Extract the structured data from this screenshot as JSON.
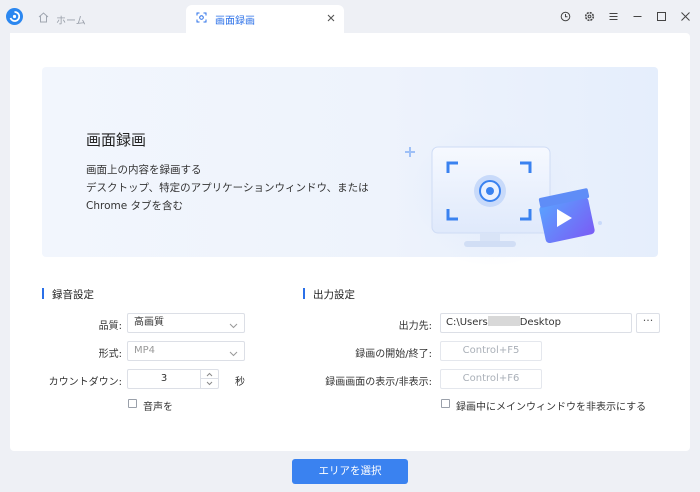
{
  "tabs": {
    "home_label": "ホーム",
    "recording_label": "画面録画"
  },
  "banner": {
    "title": "画面録画",
    "desc_line1": "画面上の内容を録画する",
    "desc_line2": "デスクトップ、特定のアプリケーションウィンドウ、または",
    "desc_line3": "Chrome タブを含む"
  },
  "audio_settings": {
    "section_title": "録音設定",
    "quality_label": "品質:",
    "quality_value": "高画質",
    "format_label": "形式:",
    "format_value": "MP4",
    "countdown_label": "カウントダウン:",
    "countdown_value": "3",
    "countdown_unit": "秒",
    "sound_label": "音声を"
  },
  "output_settings": {
    "section_title": "出力設定",
    "destination_label": "出力先:",
    "path_prefix": "C:\\Users",
    "path_suffix": "Desktop",
    "more_label": "···",
    "start_stop_label": "録画の開始/終了:",
    "start_stop_hotkey": "Control+F5",
    "show_hide_label": "録画画面の表示/非表示:",
    "show_hide_hotkey": "Control+F6",
    "hide_window_label": "録画中にメインウィンドウを非表示にする"
  },
  "footer": {
    "select_area_label": "エリアを選択"
  },
  "colors": {
    "accent": "#3a82f0",
    "tab_active_text": "#2b70e8",
    "background": "#eef0f5"
  }
}
